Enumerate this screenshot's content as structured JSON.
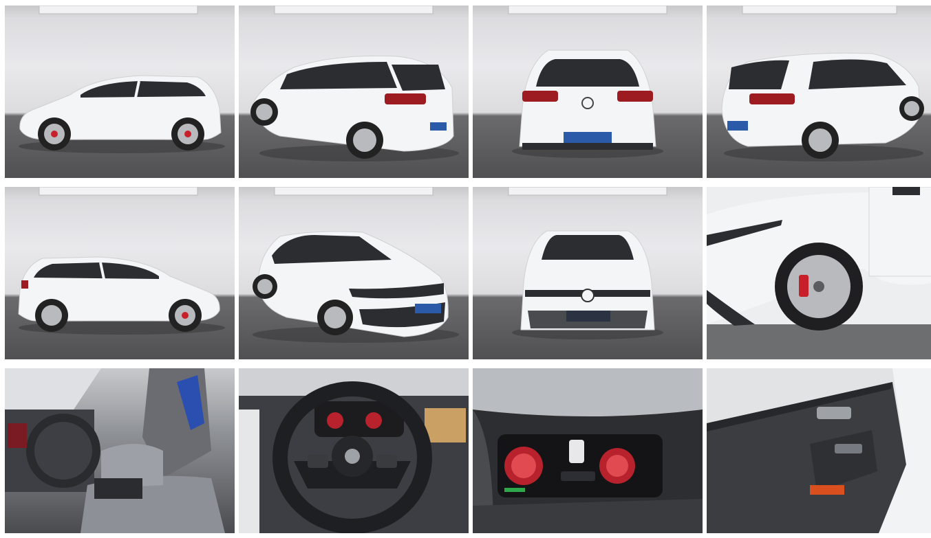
{
  "gallery": {
    "photos": [
      {
        "view": "side-left",
        "kind": "exterior"
      },
      {
        "view": "rear-three-quarter-left",
        "kind": "exterior"
      },
      {
        "view": "rear",
        "kind": "exterior"
      },
      {
        "view": "rear-three-quarter-right",
        "kind": "exterior"
      },
      {
        "view": "side-right",
        "kind": "exterior"
      },
      {
        "view": "front-three-quarter-left",
        "kind": "exterior"
      },
      {
        "view": "front",
        "kind": "exterior"
      },
      {
        "view": "front-wheel-detail",
        "kind": "detail"
      },
      {
        "view": "front-seats",
        "kind": "interior"
      },
      {
        "view": "steering-wheel",
        "kind": "interior"
      },
      {
        "view": "digital-cockpit",
        "kind": "interior"
      },
      {
        "view": "door-panel",
        "kind": "interior"
      }
    ]
  },
  "colors": {
    "car_body": "#f4f5f6",
    "studio_wall": "#e6e6e9",
    "studio_floor": "#555557",
    "caliper": "#c8202a",
    "taillight": "#9c1c22",
    "plate": "#2a5aa8"
  }
}
